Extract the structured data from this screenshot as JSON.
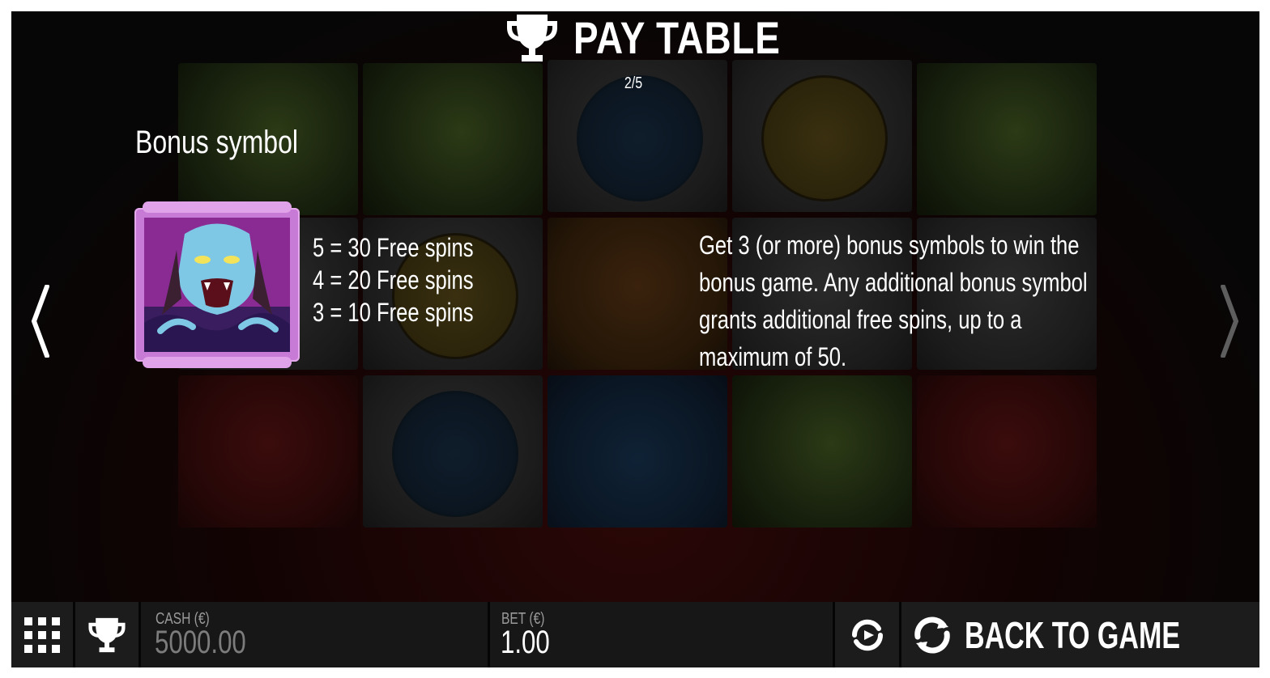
{
  "header": {
    "title": "PAY TABLE",
    "page_indicator": "2/5",
    "trophy_icon": "trophy-icon"
  },
  "content": {
    "section_title": "Bonus symbol",
    "symbol": {
      "icon": "vampire-bonus-symbol",
      "frame_color": "#c77bd6",
      "background_color": "#8a2b94"
    },
    "payouts": [
      "5 = 30 Free spins",
      "4 = 20 Free spins",
      "3 = 10 Free spins"
    ],
    "description": "Get 3 (or more) bonus symbols to win the bonus game. Any additional bonus symbol grants additional free spins, up to a maximum of 50."
  },
  "navigation": {
    "prev_icon": "chevron-left-icon",
    "next_icon": "chevron-right-icon"
  },
  "bottom_bar": {
    "menu_icon": "grid-menu-icon",
    "paytable_icon": "trophy-icon",
    "cash_label": "CASH (€)",
    "cash_value": "5000.00",
    "bet_label": "BET (€)",
    "bet_value": "1.00",
    "autoplay_icon": "autoplay-icon",
    "back_icon": "refresh-icon",
    "back_label": "BACK TO GAME"
  }
}
